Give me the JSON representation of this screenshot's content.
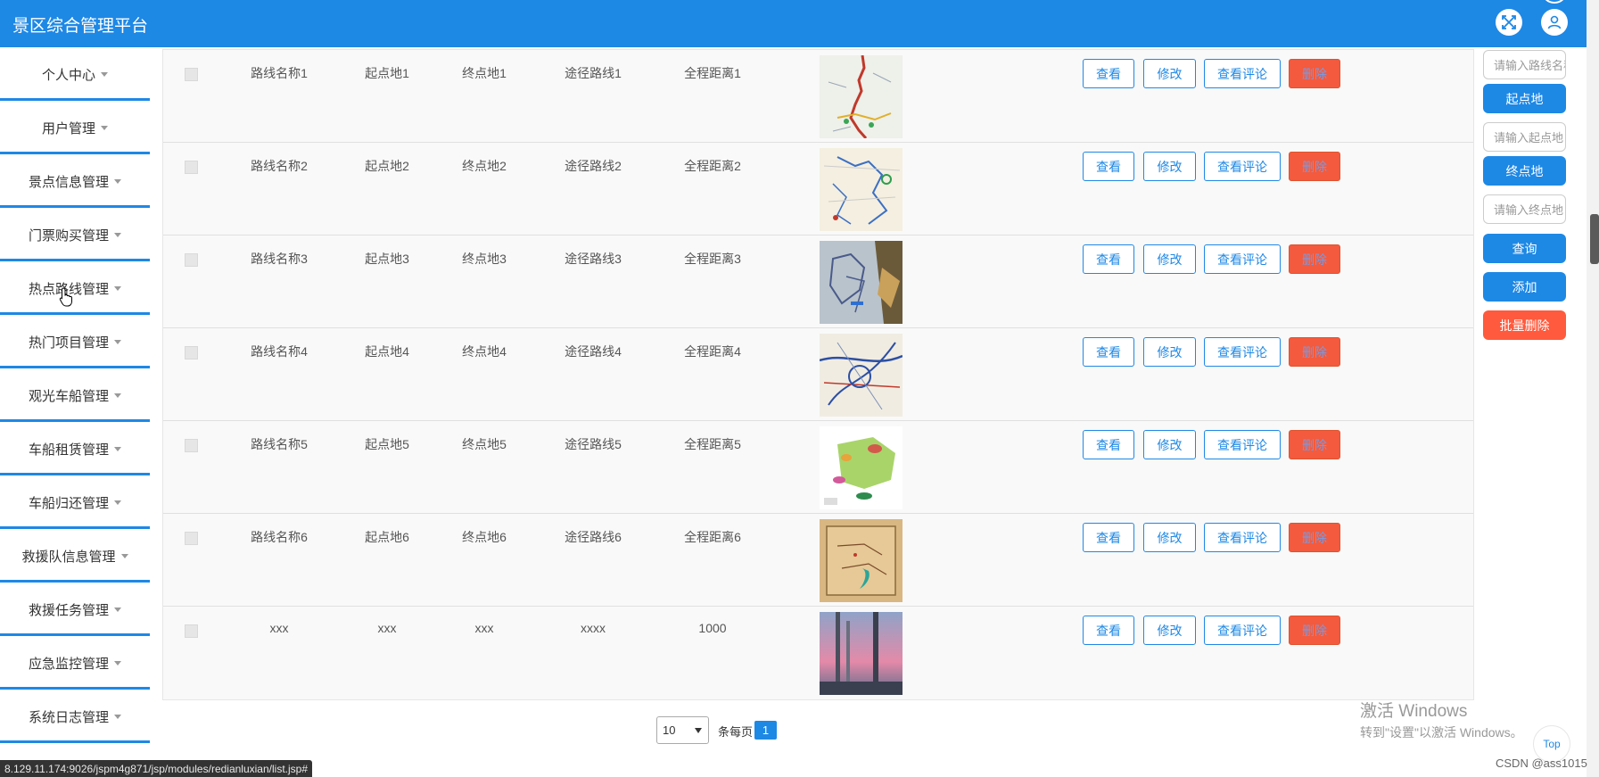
{
  "header": {
    "title": "景区综合管理平台",
    "fullscreen_icon": "expand-icon",
    "user_icon": "user-icon"
  },
  "sidebar": {
    "items": [
      {
        "label": "个人中心"
      },
      {
        "label": "用户管理"
      },
      {
        "label": "景点信息管理"
      },
      {
        "label": "门票购买管理"
      },
      {
        "label": "热点路线管理"
      },
      {
        "label": "热门项目管理"
      },
      {
        "label": "观光车船管理"
      },
      {
        "label": "车船租赁管理"
      },
      {
        "label": "车船归还管理"
      },
      {
        "label": "救援队信息管理"
      },
      {
        "label": "救援任务管理"
      },
      {
        "label": "应急监控管理"
      },
      {
        "label": "系统日志管理"
      }
    ]
  },
  "table": {
    "rows": [
      {
        "name": "路线名称1",
        "start": "起点地1",
        "end": "终点地1",
        "via": "途径路线1",
        "distance": "全程距离1"
      },
      {
        "name": "路线名称2",
        "start": "起点地2",
        "end": "终点地2",
        "via": "途径路线2",
        "distance": "全程距离2"
      },
      {
        "name": "路线名称3",
        "start": "起点地3",
        "end": "终点地3",
        "via": "途径路线3",
        "distance": "全程距离3"
      },
      {
        "name": "路线名称4",
        "start": "起点地4",
        "end": "终点地4",
        "via": "途径路线4",
        "distance": "全程距离4"
      },
      {
        "name": "路线名称5",
        "start": "起点地5",
        "end": "终点地5",
        "via": "途径路线5",
        "distance": "全程距离5"
      },
      {
        "name": "路线名称6",
        "start": "起点地6",
        "end": "终点地6",
        "via": "途径路线6",
        "distance": "全程距离6"
      },
      {
        "name": "xxx",
        "start": "xxx",
        "end": "xxx",
        "via": "xxxx",
        "distance": "1000"
      }
    ],
    "actions": {
      "view": "查看",
      "edit": "修改",
      "comments": "查看评论",
      "delete": "删除"
    }
  },
  "search_panel": {
    "route_name_placeholder": "请输入路线名称",
    "start_label": "起点地",
    "start_placeholder": "请输入起点地",
    "end_label": "终点地",
    "end_placeholder": "请输入终点地",
    "query_button": "查询",
    "add_button": "添加",
    "batch_delete_button": "批量删除"
  },
  "pagination": {
    "page_size": "10",
    "per_page_label": "条每页",
    "current_page": "1"
  },
  "overlays": {
    "windows_activation_line1": "激活 Windows",
    "windows_activation_line2": "转到\"设置\"以激活 Windows。",
    "top_button": "Top",
    "watermark": "CSDN @ass1015",
    "status_url": "8.129.11.174:9026/jspm4g871/jsp/modules/redianluxian/list.jsp#"
  },
  "colors": {
    "primary": "#1e88e5",
    "danger": "#ff5a3d",
    "row_bg": "#f9f9f9"
  }
}
